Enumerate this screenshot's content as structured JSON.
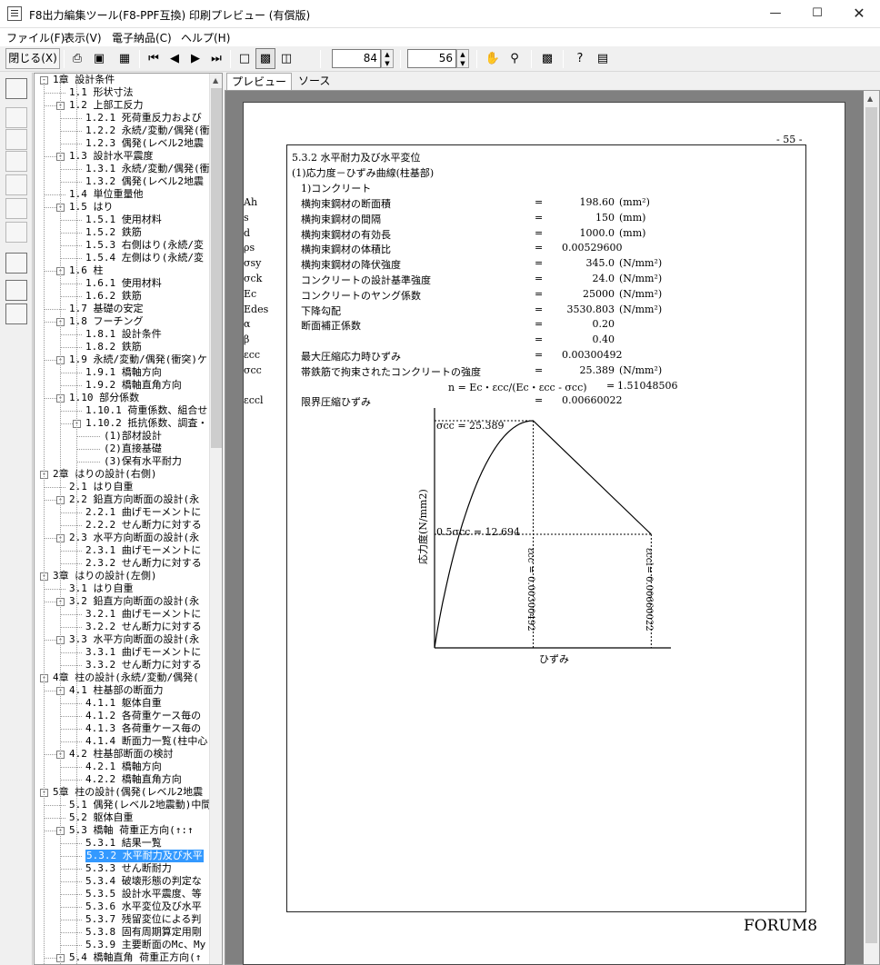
{
  "window": {
    "title": "F8出力編集ツール(F8-PPF互換) 印刷プレビュー (有償版)"
  },
  "menu": [
    "ファイル(F)",
    "表示(V)",
    "電子納品(C)",
    "ヘルプ(H)"
  ],
  "toolbar": {
    "close_label": "閉じる(X)",
    "zoom": "84",
    "page": "56"
  },
  "tabs": [
    "プレビュー",
    "ソース"
  ],
  "tree": [
    {
      "label": "1章 設計条件",
      "level": 0,
      "pm": "-"
    },
    {
      "label": "1.1 形状寸法",
      "level": 1
    },
    {
      "label": "1.2 上部工反力",
      "level": 1,
      "pm": "-"
    },
    {
      "label": "1.2.1 死荷重反力および",
      "level": 2
    },
    {
      "label": "1.2.2 永続/変動/偶発(衝",
      "level": 2
    },
    {
      "label": "1.2.3 偶発(レベル2地震",
      "level": 2
    },
    {
      "label": "1.3 設計水平震度",
      "level": 1,
      "pm": "-"
    },
    {
      "label": "1.3.1 永続/変動/偶発(衝",
      "level": 2
    },
    {
      "label": "1.3.2 偶発(レベル2地震",
      "level": 2
    },
    {
      "label": "1.4 単位重量他",
      "level": 1
    },
    {
      "label": "1.5 はり",
      "level": 1,
      "pm": "-"
    },
    {
      "label": "1.5.1 使用材料",
      "level": 2
    },
    {
      "label": "1.5.2 鉄筋",
      "level": 2
    },
    {
      "label": "1.5.3 右側はり(永続/変",
      "level": 2
    },
    {
      "label": "1.5.4 左側はり(永続/変",
      "level": 2
    },
    {
      "label": "1.6 柱",
      "level": 1,
      "pm": "-"
    },
    {
      "label": "1.6.1 使用材料",
      "level": 2
    },
    {
      "label": "1.6.2 鉄筋",
      "level": 2
    },
    {
      "label": "1.7 基礎の安定",
      "level": 1
    },
    {
      "label": "1.8 フーチング",
      "level": 1,
      "pm": "-"
    },
    {
      "label": "1.8.1 設計条件",
      "level": 2
    },
    {
      "label": "1.8.2 鉄筋",
      "level": 2
    },
    {
      "label": "1.9 永続/変動/偶発(衝突)ケ",
      "level": 1,
      "pm": "-"
    },
    {
      "label": "1.9.1 橋軸方向",
      "level": 2
    },
    {
      "label": "1.9.2 橋軸直角方向",
      "level": 2
    },
    {
      "label": "1.10 部分係数",
      "level": 1,
      "pm": "-"
    },
    {
      "label": "1.10.1 荷重係数、組合せ",
      "level": 2
    },
    {
      "label": "1.10.2 抵抗係数、調査・",
      "level": 2,
      "pm": "-"
    },
    {
      "label": "(1)部材設計",
      "level": 3
    },
    {
      "label": "(2)直接基礎",
      "level": 3
    },
    {
      "label": "(3)保有水平耐力",
      "level": 3
    },
    {
      "label": "2章 はりの設計(右側)",
      "level": 0,
      "pm": "-"
    },
    {
      "label": "2.1 はり自重",
      "level": 1
    },
    {
      "label": "2.2 鉛直方向断面の設計(永",
      "level": 1,
      "pm": "-"
    },
    {
      "label": "2.2.1 曲げモーメントに",
      "level": 2
    },
    {
      "label": "2.2.2 せん断力に対する",
      "level": 2
    },
    {
      "label": "2.3 水平方向断面の設計(永",
      "level": 1,
      "pm": "-"
    },
    {
      "label": "2.3.1 曲げモーメントに",
      "level": 2
    },
    {
      "label": "2.3.2 せん断力に対する",
      "level": 2
    },
    {
      "label": "3章 はりの設計(左側)",
      "level": 0,
      "pm": "-"
    },
    {
      "label": "3.1 はり自重",
      "level": 1
    },
    {
      "label": "3.2 鉛直方向断面の設計(永",
      "level": 1,
      "pm": "-"
    },
    {
      "label": "3.2.1 曲げモーメントに",
      "level": 2
    },
    {
      "label": "3.2.2 せん断力に対する",
      "level": 2
    },
    {
      "label": "3.3 水平方向断面の設計(永",
      "level": 1,
      "pm": "-"
    },
    {
      "label": "3.3.1 曲げモーメントに",
      "level": 2
    },
    {
      "label": "3.3.2 せん断力に対する",
      "level": 2
    },
    {
      "label": "4章 柱の設計(永続/変動/偶発(",
      "level": 0,
      "pm": "-"
    },
    {
      "label": "4.1 柱基部の断面力",
      "level": 1,
      "pm": "-"
    },
    {
      "label": "4.1.1 躯体自重",
      "level": 2
    },
    {
      "label": "4.1.2 各荷重ケース毎の",
      "level": 2
    },
    {
      "label": "4.1.3 各荷重ケース毎の",
      "level": 2
    },
    {
      "label": "4.1.4 断面力一覧(柱中心",
      "level": 2
    },
    {
      "label": "4.2 柱基部断面の検討",
      "level": 1,
      "pm": "-"
    },
    {
      "label": "4.2.1 橋軸方向",
      "level": 2
    },
    {
      "label": "4.2.2 橋軸直角方向",
      "level": 2
    },
    {
      "label": "5章 柱の設計(偶発(レベル2地震",
      "level": 0,
      "pm": "-"
    },
    {
      "label": "5.1 偶発(レベル2地震動)中間",
      "level": 1
    },
    {
      "label": "5.2 躯体自重",
      "level": 1
    },
    {
      "label": "5.3 橋軸 荷重正方向(↑:↑",
      "level": 1,
      "pm": "-"
    },
    {
      "label": "5.3.1 結果一覧",
      "level": 2
    },
    {
      "label": "5.3.2 水平耐力及び水平",
      "level": 2,
      "selected": true
    },
    {
      "label": "5.3.3 せん断耐力",
      "level": 2
    },
    {
      "label": "5.3.4 破壊形態の判定な",
      "level": 2
    },
    {
      "label": "5.3.5 設計水平震度、等",
      "level": 2
    },
    {
      "label": "5.3.6 水平変位及び水平",
      "level": 2
    },
    {
      "label": "5.3.7 残留変位による判",
      "level": 2
    },
    {
      "label": "5.3.8 固有周期算定用剛",
      "level": 2
    },
    {
      "label": "5.3.9 主要断面のMc、My",
      "level": 2
    },
    {
      "label": "5.4 橋軸直角 荷重正方向(↑",
      "level": 1,
      "pm": "-"
    }
  ],
  "doc": {
    "page_number": "- 55 -",
    "section": "5.3.2 水平耐力及び水平変位",
    "subsection": "(1)応力度－ひずみ曲線(柱基部)",
    "item": "1)コンクリート",
    "rows": [
      {
        "label": "横拘束鋼材の断面積",
        "sym": "Ah",
        "eq": "=",
        "val": "198.60",
        "unit": "(mm²)"
      },
      {
        "label": "横拘束鋼材の間隔",
        "sym": "s",
        "eq": "=",
        "val": "150",
        "unit": "(mm)"
      },
      {
        "label": "横拘束鋼材の有効長",
        "sym": "d",
        "eq": "=",
        "val": "1000.0",
        "unit": "(mm)"
      },
      {
        "label": "横拘束鋼材の体積比",
        "sym": "ρs",
        "eq": "=",
        "val": "0.00529600",
        "unit": ""
      },
      {
        "label": "横拘束鋼材の降伏強度",
        "sym": "σsy",
        "eq": "=",
        "val": "345.0",
        "unit": "(N/mm²)"
      },
      {
        "label": "コンクリートの設計基準強度",
        "sym": "σck",
        "eq": "=",
        "val": "24.0",
        "unit": "(N/mm²)"
      },
      {
        "label": "コンクリートのヤング係数",
        "sym": "Ec",
        "eq": "=",
        "val": "25000",
        "unit": "(N/mm²)"
      },
      {
        "label": "下降勾配",
        "sym": "Edes",
        "eq": "=",
        "val": "3530.803",
        "unit": "(N/mm²)"
      },
      {
        "label": "断面補正係数",
        "sym": "α",
        "eq": "=",
        "val": "0.20",
        "unit": ""
      },
      {
        "label": "",
        "sym": "β",
        "eq": "=",
        "val": "0.40",
        "unit": ""
      },
      {
        "label": "最大圧縮応力時ひずみ",
        "sym": "εcc",
        "eq": "=",
        "val": "0.00300492",
        "unit": ""
      },
      {
        "label": "帯鉄筋で拘束されたコンクリートの強度",
        "sym": "σcc",
        "eq": "=",
        "val": "25.389",
        "unit": "(N/mm²)"
      },
      {
        "label": "",
        "sym": "n = Ec・εcc/(Ec・εcc - σcc)",
        "eq": "=",
        "val": "1.51048506",
        "unit": ""
      },
      {
        "label": "限界圧縮ひずみ",
        "sym": "εccl",
        "eq": "=",
        "val": "0.00660022",
        "unit": ""
      }
    ],
    "chart": {
      "peak_label": "σcc =  25.389",
      "half_label": "0.5σcc =  12.694",
      "ylabel": "応力度(N/mm2)",
      "xlabel": "ひずみ",
      "ecc_label": "εcc = 0.00300492",
      "eccl_label": "εccl= 0.00660022"
    },
    "footer": "FORUM8"
  }
}
